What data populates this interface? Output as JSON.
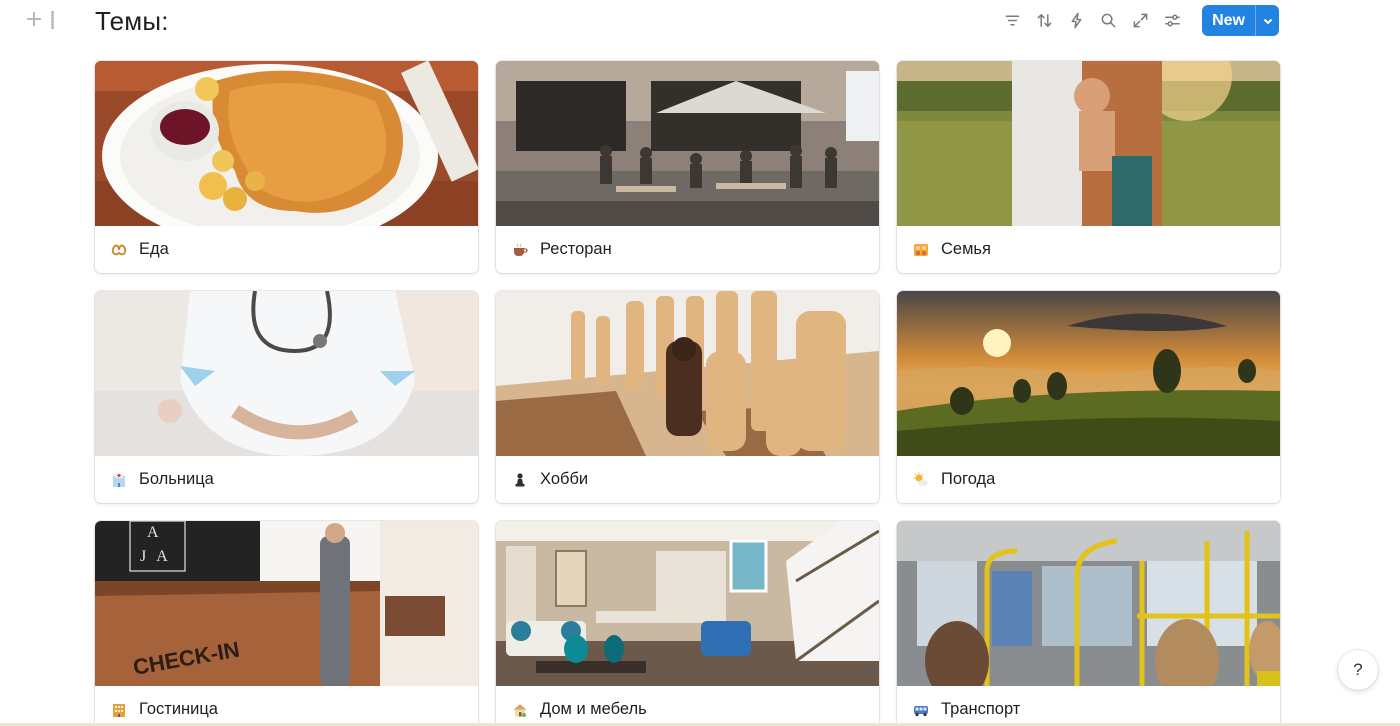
{
  "page": {
    "title": "Темы:",
    "new_button_label": "New",
    "help_label": "?"
  },
  "toolbar": {
    "icons": [
      "filter-icon",
      "sort-icon",
      "automation-icon",
      "search-icon",
      "expand-icon",
      "settings-icon",
      "chevron-down-icon"
    ]
  },
  "cards": [
    {
      "label": "Еда",
      "icon": "pretzel-icon",
      "cover": "food-photo"
    },
    {
      "label": "Ресторан",
      "icon": "coffee-icon",
      "cover": "restaurant-photo"
    },
    {
      "label": "Семья",
      "icon": "family-icon",
      "cover": "family-photo"
    },
    {
      "label": "Больница",
      "icon": "hospital-icon",
      "cover": "hospital-photo"
    },
    {
      "label": "Хобби",
      "icon": "chess-pawn-icon",
      "cover": "chess-photo"
    },
    {
      "label": "Погода",
      "icon": "sun-behind-cloud-icon",
      "cover": "sunset-photo"
    },
    {
      "label": "Гостиница",
      "icon": "hotel-icon",
      "cover": "hotel-photo"
    },
    {
      "label": "Дом и мебель",
      "icon": "house-icon",
      "cover": "living-room-photo"
    },
    {
      "label": "Транспорт",
      "icon": "bus-icon",
      "cover": "bus-photo"
    }
  ],
  "colors": {
    "accent": "#2383e2",
    "text": "#37352f"
  }
}
